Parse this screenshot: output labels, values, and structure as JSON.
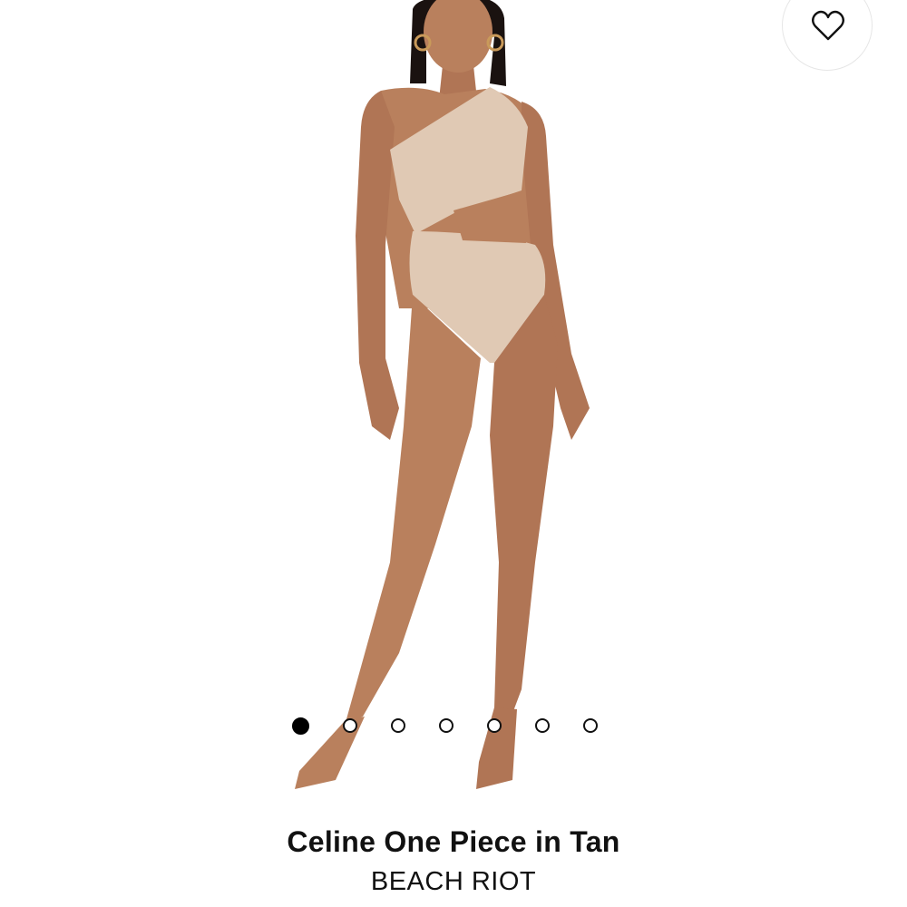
{
  "product": {
    "title": "Celine One Piece in Tan",
    "brand": "BEACH RIOT"
  },
  "gallery": {
    "image_count": 7,
    "active_index": 0
  },
  "wishlist": {
    "icon": "heart-outline-icon"
  },
  "colors": {
    "skin": "#b9805d",
    "swimsuit": "#e0c9b4",
    "hair": "#1a1210",
    "dot_active": "#000000"
  }
}
